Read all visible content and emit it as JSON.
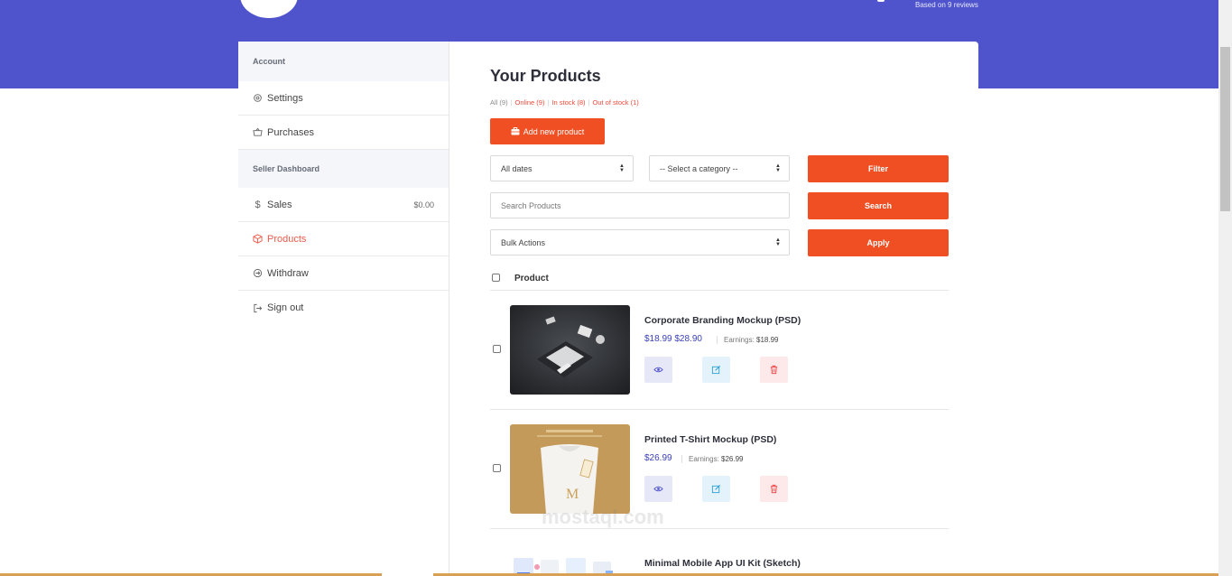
{
  "header": {
    "reviews_text": "Based on 9 reviews"
  },
  "sidebar": {
    "account_heading": "Account",
    "account_items": [
      {
        "label": "Settings",
        "icon": "gear-icon"
      },
      {
        "label": "Purchases",
        "icon": "basket-icon"
      }
    ],
    "seller_heading": "Seller Dashboard",
    "seller_items": [
      {
        "label": "Sales",
        "icon": "dollar-icon",
        "amount": "$0.00"
      },
      {
        "label": "Products",
        "icon": "box-icon"
      },
      {
        "label": "Withdraw",
        "icon": "withdraw-icon"
      },
      {
        "label": "Sign out",
        "icon": "sign-out-icon"
      }
    ]
  },
  "main": {
    "title": "Your Products",
    "status_links": [
      {
        "label": "All (9)"
      },
      {
        "label": "Online (9)"
      },
      {
        "label": "In stock (8)"
      },
      {
        "label": "Out of stock (1)"
      }
    ],
    "add_button": "Add new product",
    "date_select": "All dates",
    "category_select": "-- Select a category --",
    "filter_button": "Filter",
    "search_placeholder": "Search Products",
    "search_button": "Search",
    "bulk_select": "Bulk Actions",
    "apply_button": "Apply",
    "table_header": "Product",
    "earnings_label": "Earnings:",
    "products": [
      {
        "name": "Corporate Branding Mockup (PSD)",
        "price": "$18.99 $28.90",
        "earnings": "$18.99"
      },
      {
        "name": "Printed T-Shirt Mockup (PSD)",
        "price": "$26.99",
        "earnings": "$26.99"
      },
      {
        "name": "Minimal Mobile App UI Kit (Sketch)"
      }
    ]
  },
  "watermark": "mostaql.com",
  "colors": {
    "header_bg": "#4f54cc",
    "accent": "#f04e23",
    "price": "#3b41b8",
    "active_link": "#ef5a4a"
  }
}
